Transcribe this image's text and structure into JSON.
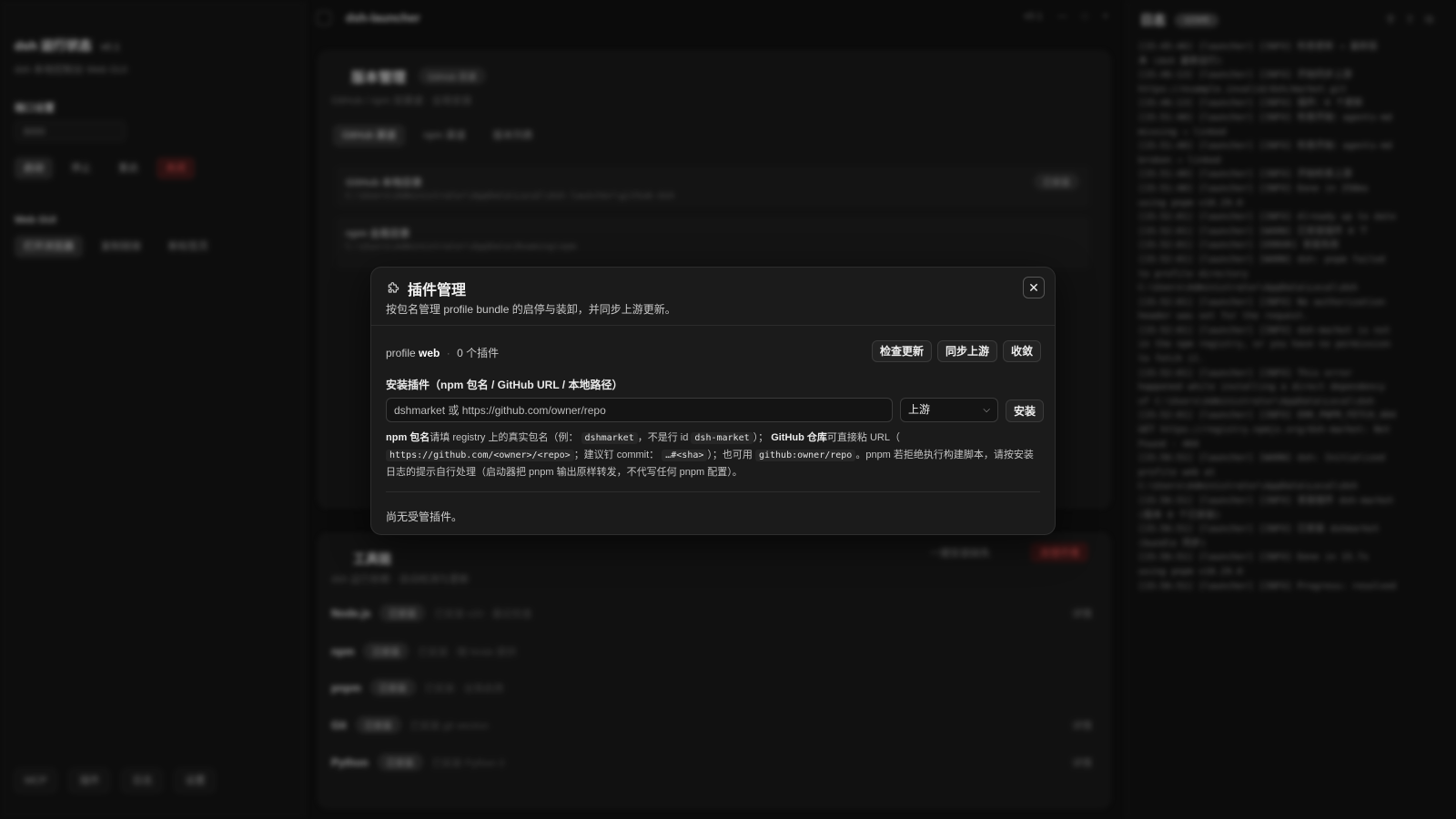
{
  "background": {
    "sidebar": {
      "title": "dsh 运行状态",
      "version": "v0.1",
      "subtitle": "dsh 本地控制台 Web GUI",
      "port_label": "端口设置",
      "port_value": "3000",
      "actions": [
        "启动",
        "停止",
        "重启",
        "关闭"
      ],
      "webgui_label": "Web GUI",
      "webgui_actions": [
        "打开浏览器",
        "复制链接",
        "新标签页"
      ],
      "footer": [
        "MCP",
        "插件",
        "日志",
        "设置"
      ]
    },
    "topbar": {
      "title": "dsh-launcher",
      "controls": [
        "v0.1",
        "—",
        "□",
        "×"
      ]
    },
    "version_card": {
      "title": "版本管理",
      "badge": "GitHub 目录",
      "subtitle": "GitHub / npm 双渠道 · 全局安装",
      "tabs": [
        "GitHub 渠道",
        "npm 渠道",
        "版本列表"
      ],
      "blocks": [
        {
          "heading": "GitHub 本地目录",
          "path": "C:\\Users\\Administrator\\AppData\\Local\\dsh-launcher\\github-dsh",
          "tag": "已安装"
        },
        {
          "heading": "npm 全局目录",
          "path": "C:\\Users\\Administrator\\AppData\\Roaming\\npm",
          "tag": ""
        }
      ]
    },
    "tools_card": {
      "title": "工具链",
      "subtitle": "dsh 运行依赖 · 自动检测与更新",
      "primary_action": "一键安装缺失",
      "danger_action": "清理环境",
      "tools": [
        {
          "name": "Node.js",
          "badge": "已安装",
          "detail": "已安装 v20 · 最近检查",
          "action": "详情"
        },
        {
          "name": "npm",
          "badge": "已安装",
          "detail": "已安装 · 随 Node 提供",
          "action": ""
        },
        {
          "name": "pnpm",
          "badge": "已安装",
          "detail": "已安装 · 全局启用",
          "action": ""
        },
        {
          "name": "Git",
          "badge": "已安装",
          "detail": "已安装 git version",
          "action": "详情"
        },
        {
          "name": "Python",
          "badge": "已安装",
          "detail": "已安装 Python 3",
          "action": "详情"
        }
      ]
    },
    "log_panel": {
      "title": "日志",
      "count_badge": "12345",
      "icons": [
        "pin-icon",
        "upload-icon",
        "copy-icon"
      ],
      "lines": [
        "[15:45:46] [launcher] [INFO] 检查更新 → 最新版",
        "本 (dsh 最新运行)",
        "[15:46:13] [launcher] [INFO] 开始同步上游",
        "https://example.invalid/dsh/market.git",
        "[15:46:13] [launcher] [INFO] 插件：0 个更新",
        "[15:51:40] [launcher] [INFO] 检查开始：agents-md",
        "missing → linked",
        "[15:51:40] [launcher] [INFO] 检查开始：agents-md",
        "broken → linked",
        "[15:51:40] [launcher] [INFO] 开始检查上游",
        "[15:51:40] [launcher] [INFO] Done in 258ms",
        "using pnpm v10.29.0",
        "[15:52:01] [launcher] [INFO] Already up to date",
        "[15:52:01] [launcher] [WARN] 已安装插件 0 个",
        "[15:52:01] [launcher] [ERROR] 安装失败",
        "[15:52:01] [launcher] [WARN] dsh: pnpm failed",
        "to profile directory",
        "C:\\Users\\Administrator\\AppData\\Local\\dsh",
        "[15:52:01] [launcher] [INFO] No authorization",
        "header was set for the request.",
        "[15:52:01] [launcher] [INFO] dsh-market is not",
        "in the npm registry, or you have no permission",
        "to fetch it.",
        "[15:52:01] [launcher] [INFO] This error",
        "happened while installing a direct dependency",
        "of C:\\Users\\Administrator\\AppData\\Local\\dsh",
        "[15:52:01] [launcher] [INFO] ERR_PNPM_FETCH_404",
        "GET https://registry.npmjs.org/dsh-market: Not",
        "Found - 404",
        "[15:56:51] [launcher] [WARN] dsh: Initialized",
        "profile web at",
        "C:\\Users\\Administrator\\AppData\\Local\\dsh",
        "[15:56:51] [launcher] [INFO] 安装插件 dsh-market",
        "(版本 0 个已安装)",
        "[15:56:51] [launcher] [INFO] 已安装 dshmarket",
        "(bundle 同步)",
        "[15:56:51] [launcher] [INFO] Done in 15.7s",
        "using pnpm v10.29.0",
        "[15:56:51] [launcher] [INFO] Progress: resolved"
      ]
    }
  },
  "modal": {
    "title": "插件管理",
    "description": "按包名管理 profile bundle 的启停与装卸，并同步上游更新。",
    "profile_prefix": "profile",
    "profile_name": "web",
    "separator": "·",
    "plugin_count": "0 个插件",
    "actions": {
      "check_updates": "检查更新",
      "sync_upstream": "同步上游",
      "collapse": "收敛"
    },
    "install_label": "安装插件（npm 包名 / GitHub URL / 本地路径）",
    "install_placeholder": "dshmarket 或 https://github.com/owner/repo",
    "source_select": "上游",
    "install_button": "安装",
    "help": {
      "npm_bold": "npm 包名",
      "t1": "请填 registry 上的真实包名（例：",
      "code1": "dshmarket",
      "t2": "，不是行 id",
      "code2": "dsh-market",
      "t3": "）；",
      "github_bold": "GitHub 仓库",
      "t4": "可直接粘 URL（",
      "code3": "https://github.com/<owner>/<repo>",
      "t5": "；建议钉 commit：",
      "code4": "…#<sha>",
      "t6": "）；也可用",
      "code5": "github:owner/repo",
      "t7": "。pnpm 若拒绝执行构建脚本，请按安装日志的提示自行处理（启动器把 pnpm 输出原样转发，不代写任何 pnpm 配置）。"
    },
    "empty_text": "尚无受管插件。"
  }
}
